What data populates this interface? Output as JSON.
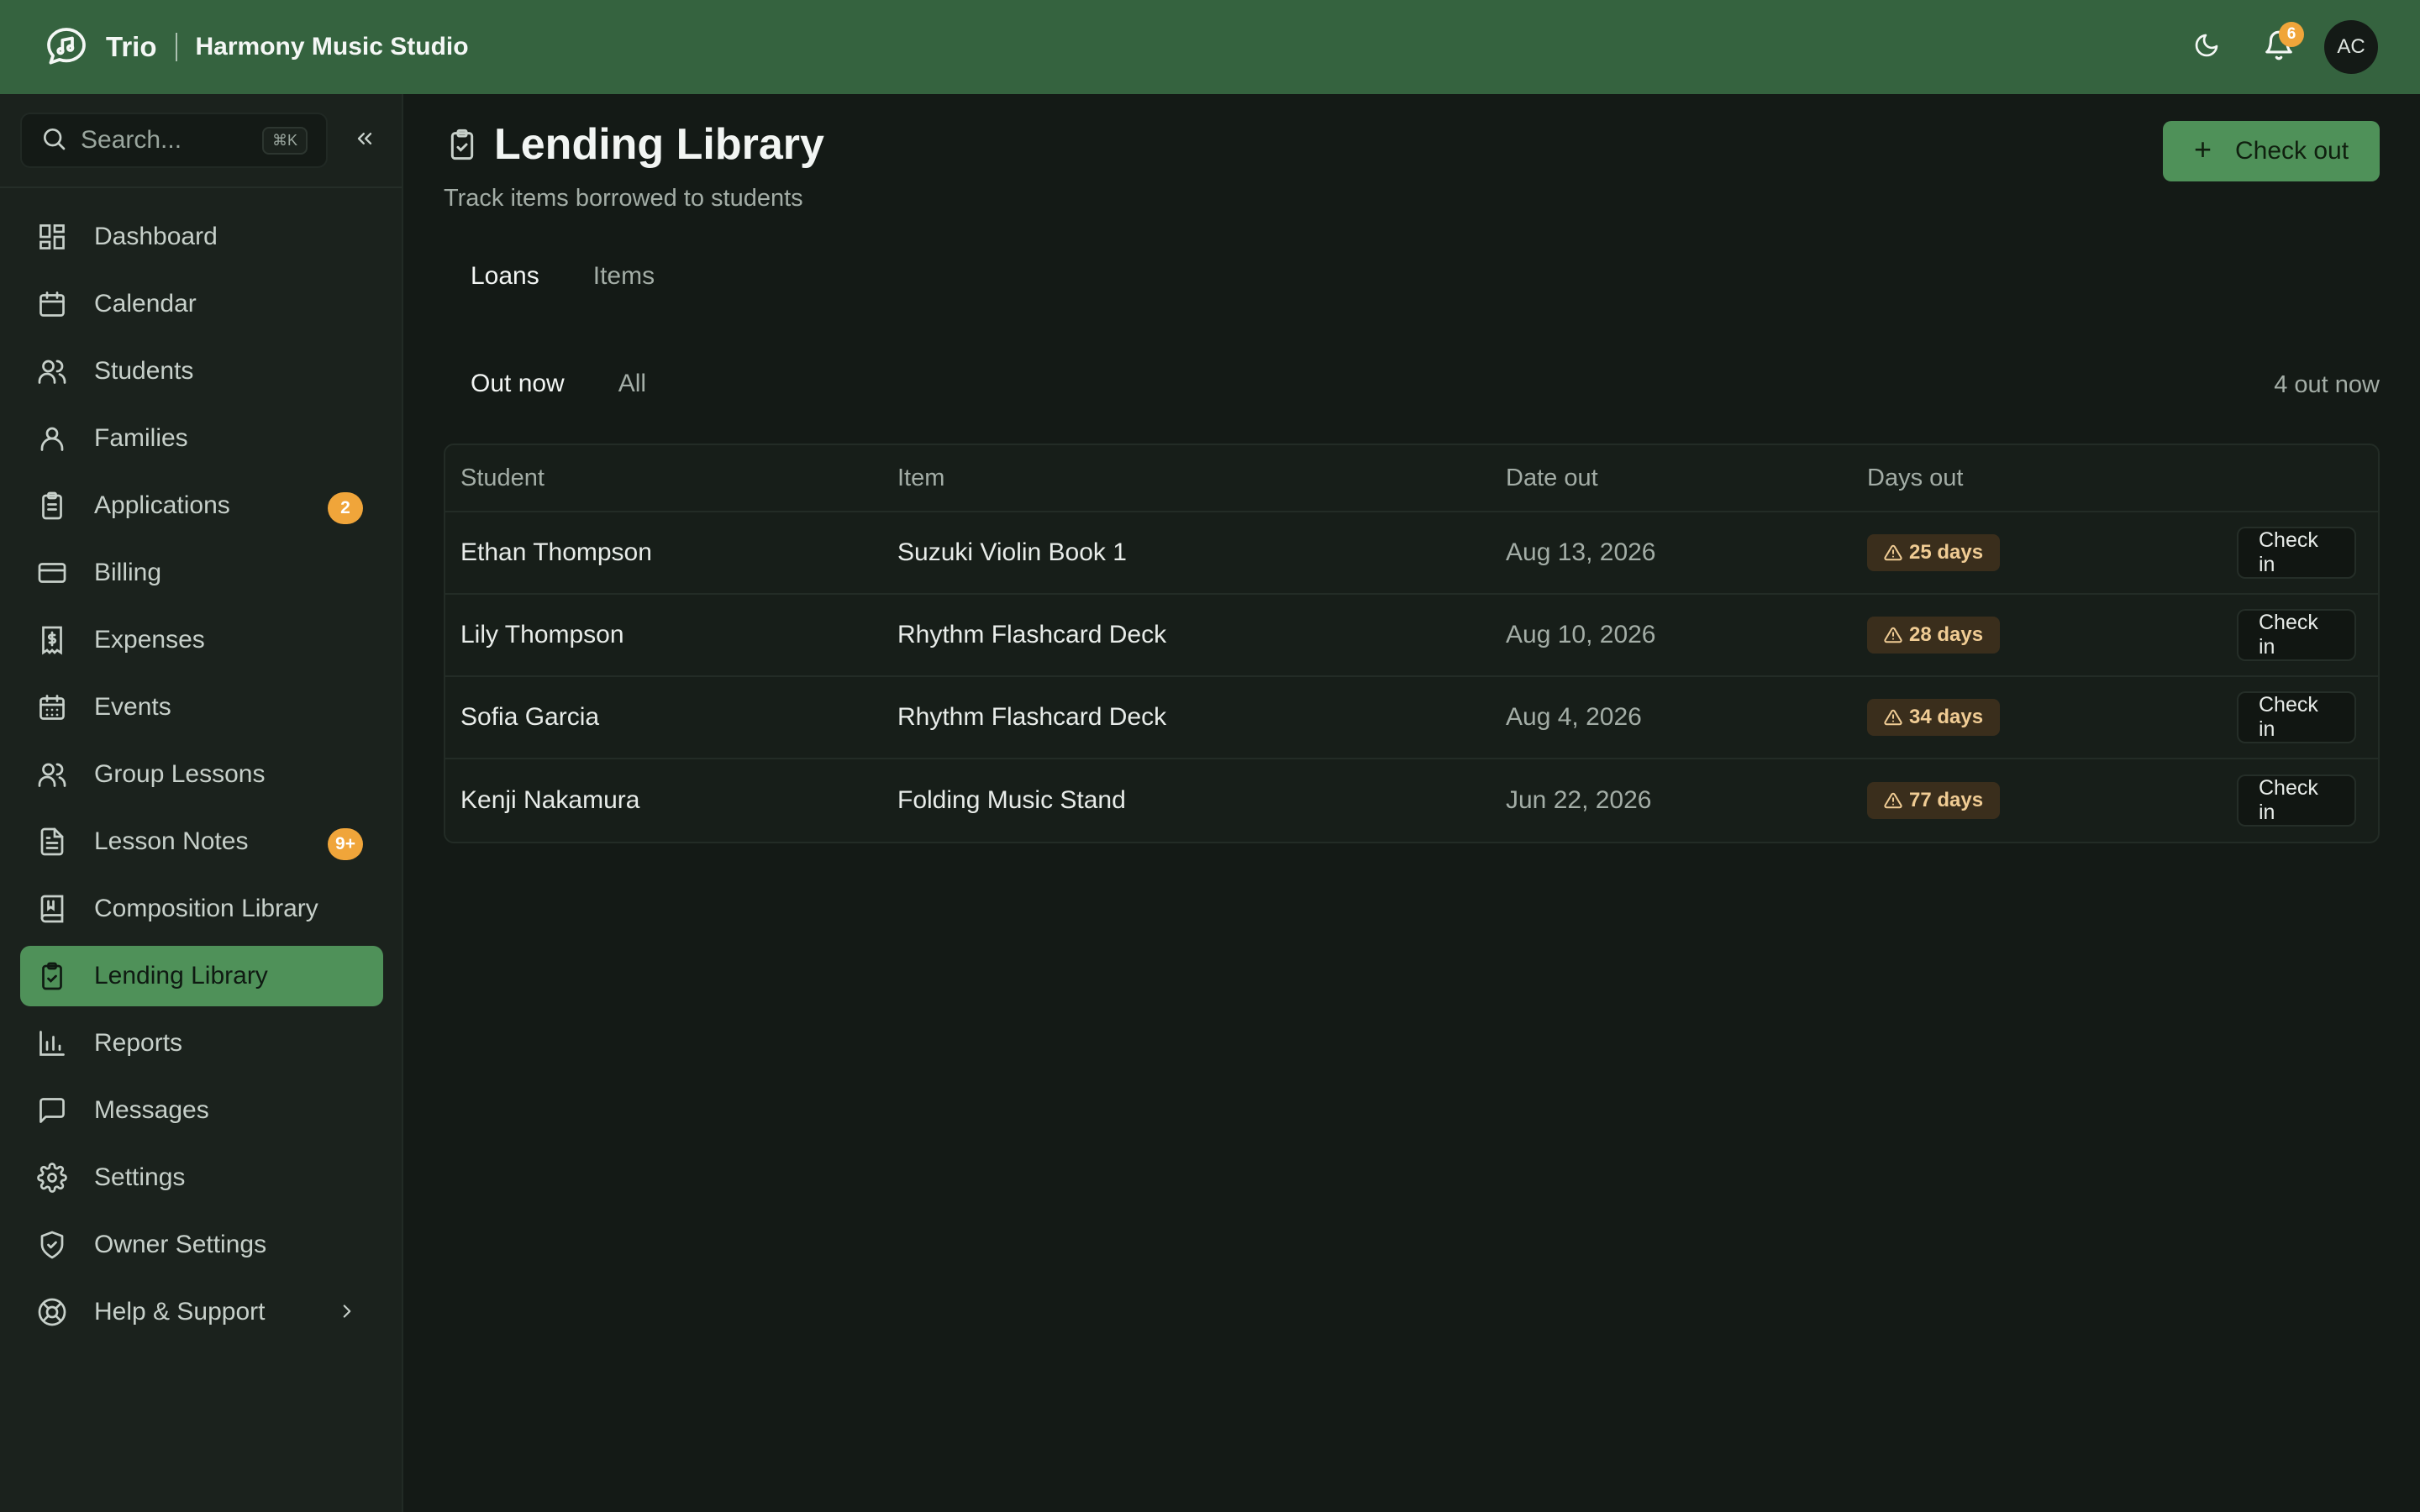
{
  "topbar": {
    "app_name": "Trio",
    "studio_name": "Harmony Music Studio",
    "notification_count": "6",
    "avatar_initials": "AC"
  },
  "sidebar": {
    "search_placeholder": "Search...",
    "search_shortcut": "⌘K",
    "items": [
      {
        "label": "Dashboard",
        "icon": "dashboard-icon"
      },
      {
        "label": "Calendar",
        "icon": "calendar-icon"
      },
      {
        "label": "Students",
        "icon": "students-icon"
      },
      {
        "label": "Families",
        "icon": "user-icon"
      },
      {
        "label": "Applications",
        "icon": "clipboard-icon",
        "badge": "2"
      },
      {
        "label": "Billing",
        "icon": "credit-card-icon"
      },
      {
        "label": "Expenses",
        "icon": "receipt-icon"
      },
      {
        "label": "Events",
        "icon": "calendar-grid-icon"
      },
      {
        "label": "Group Lessons",
        "icon": "group-icon"
      },
      {
        "label": "Lesson Notes",
        "icon": "document-icon",
        "badge": "9+"
      },
      {
        "label": "Composition Library",
        "icon": "book-icon"
      },
      {
        "label": "Lending Library",
        "icon": "clipboard-check-icon",
        "active": true
      },
      {
        "label": "Reports",
        "icon": "bar-chart-icon"
      },
      {
        "label": "Messages",
        "icon": "message-icon"
      },
      {
        "label": "Settings",
        "icon": "gear-icon"
      },
      {
        "label": "Owner Settings",
        "icon": "shield-icon"
      },
      {
        "label": "Help & Support",
        "icon": "lifebuoy-icon"
      }
    ]
  },
  "page": {
    "title": "Lending Library",
    "subtitle": "Track items borrowed to students",
    "primary_action": "Check out",
    "tabs": [
      "Loans",
      "Items"
    ],
    "subtabs": [
      "Out now",
      "All"
    ],
    "count_text": "4 out now"
  },
  "table": {
    "headers": [
      "Student",
      "Item",
      "Date out",
      "Days out"
    ],
    "rows": [
      {
        "student": "Ethan Thompson",
        "item": "Suzuki Violin Book 1",
        "date_out": "Aug 13, 2026",
        "days_out": "25 days",
        "action": "Check in"
      },
      {
        "student": "Lily Thompson",
        "item": "Rhythm Flashcard Deck",
        "date_out": "Aug 10, 2026",
        "days_out": "28 days",
        "action": "Check in"
      },
      {
        "student": "Sofia Garcia",
        "item": "Rhythm Flashcard Deck",
        "date_out": "Aug 4, 2026",
        "days_out": "34 days",
        "action": "Check in"
      },
      {
        "student": "Kenji Nakamura",
        "item": "Folding Music Stand",
        "date_out": "Jun 22, 2026",
        "days_out": "77 days",
        "action": "Check in"
      }
    ]
  },
  "colors": {
    "topbar": "#35633f",
    "accent": "#4f9159",
    "badge": "#f0a53a",
    "warning_bg": "#3a2e1c",
    "warning_text": "#f0cc94"
  }
}
